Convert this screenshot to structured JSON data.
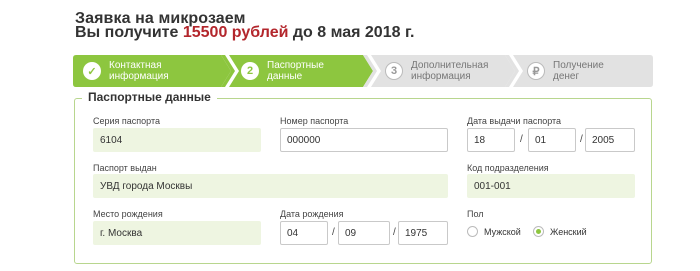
{
  "header": {
    "line1": "Заявка на микрозаем",
    "line2_prefix": "Вы получите ",
    "amount": "15500 рублей",
    "line2_suffix": " до 8 мая 2018 г."
  },
  "steps": [
    {
      "number": "✓",
      "label_line1": "Контактная",
      "label_line2": "информация",
      "state": "done"
    },
    {
      "number": "2",
      "label_line1": "Паспортные",
      "label_line2": "данные",
      "state": "active"
    },
    {
      "number": "3",
      "label_line1": "Дополнительная",
      "label_line2": "информация",
      "state": "pending"
    },
    {
      "number": "₽",
      "label_line1": "Получение",
      "label_line2": "денег",
      "state": "pending"
    }
  ],
  "section_title": "Паспортные данные",
  "fields": {
    "series": {
      "label": "Серия паспорта",
      "value": "6104"
    },
    "number": {
      "label": "Номер паспорта",
      "value": "000000"
    },
    "issue_date": {
      "label": "Дата выдачи паспорта",
      "day": "18",
      "month": "01",
      "year": "2005"
    },
    "issued_by": {
      "label": "Паспорт выдан",
      "value": "УВД города Москвы"
    },
    "dept_code": {
      "label": "Код подразделения",
      "value": "001-001"
    },
    "birth_place": {
      "label": "Место рождения",
      "value": "г. Москва"
    },
    "birth_date": {
      "label": "Дата рождения",
      "day": "04",
      "month": "09",
      "year": "1975"
    },
    "gender": {
      "label": "Пол",
      "options": [
        "Мужской",
        "Женский"
      ],
      "selected": "Женский"
    }
  },
  "date_separator": "/",
  "colors": {
    "accent": "#8dc63f",
    "amount": "#b3262c",
    "pending": "#e2e2e2",
    "field_fill": "#eef5e1"
  }
}
